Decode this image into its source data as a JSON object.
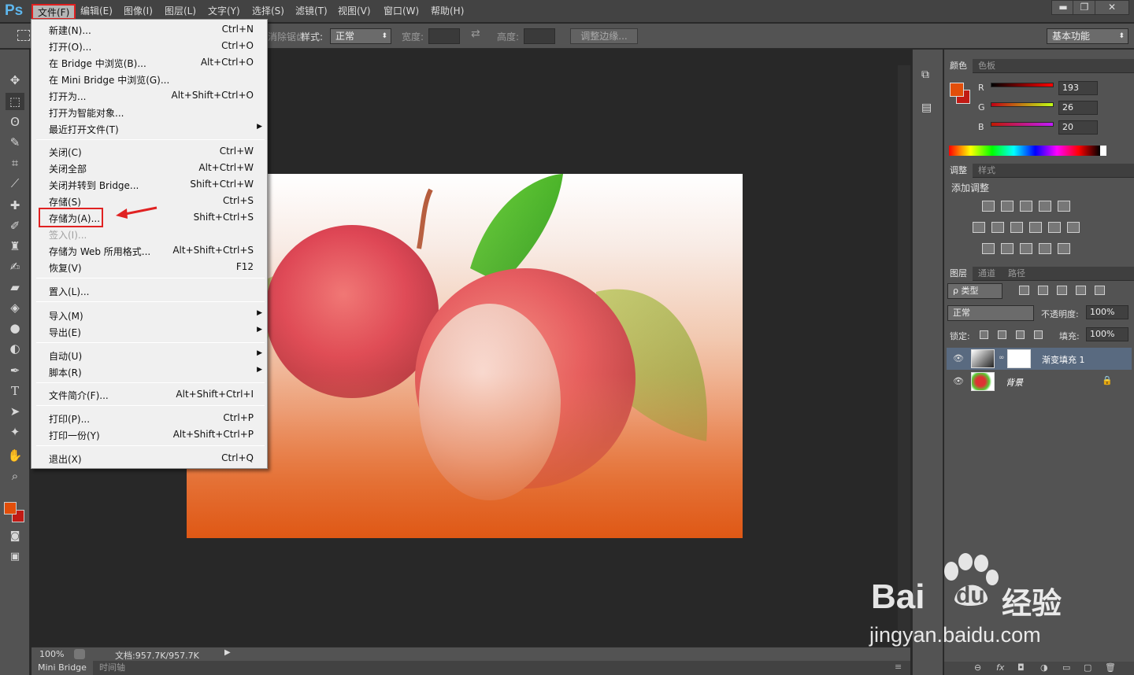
{
  "app": {
    "logo": "Ps"
  },
  "menubar": {
    "items": [
      "文件(F)",
      "编辑(E)",
      "图像(I)",
      "图层(L)",
      "文字(Y)",
      "选择(S)",
      "滤镜(T)",
      "视图(V)",
      "窗口(W)",
      "帮助(H)"
    ],
    "window_buttons": [
      "▬",
      "❐",
      "✕"
    ]
  },
  "options": {
    "antialias_label": "消除锯齿",
    "style_label": "样式:",
    "style_value": "正常",
    "width_label": "宽度:",
    "height_label": "高度:",
    "refine_label": "调整边缘...",
    "workspace": "基本功能"
  },
  "file_menu": [
    {
      "label": "新建(N)...",
      "shortcut": "Ctrl+N"
    },
    {
      "label": "打开(O)...",
      "shortcut": "Ctrl+O"
    },
    {
      "label": "在 Bridge 中浏览(B)...",
      "shortcut": "Alt+Ctrl+O"
    },
    {
      "label": "在 Mini Bridge 中浏览(G)...",
      "shortcut": ""
    },
    {
      "label": "打开为...",
      "shortcut": "Alt+Shift+Ctrl+O"
    },
    {
      "label": "打开为智能对象...",
      "shortcut": ""
    },
    {
      "label": "最近打开文件(T)",
      "shortcut": "",
      "submenu": true
    },
    {
      "label": "关闭(C)",
      "shortcut": "Ctrl+W"
    },
    {
      "label": "关闭全部",
      "shortcut": "Alt+Ctrl+W"
    },
    {
      "label": "关闭并转到 Bridge...",
      "shortcut": "Shift+Ctrl+W"
    },
    {
      "label": "存储(S)",
      "shortcut": "Ctrl+S"
    },
    {
      "label": "存储为(A)...",
      "shortcut": "Shift+Ctrl+S",
      "highlighted": true
    },
    {
      "label": "签入(I)...",
      "shortcut": "",
      "disabled": true
    },
    {
      "label": "存储为 Web 所用格式...",
      "shortcut": "Alt+Shift+Ctrl+S"
    },
    {
      "label": "恢复(V)",
      "shortcut": "F12"
    },
    {
      "label": "置入(L)...",
      "shortcut": ""
    },
    {
      "label": "导入(M)",
      "shortcut": "",
      "submenu": true
    },
    {
      "label": "导出(E)",
      "shortcut": "",
      "submenu": true
    },
    {
      "label": "自动(U)",
      "shortcut": "",
      "submenu": true
    },
    {
      "label": "脚本(R)",
      "shortcut": "",
      "submenu": true
    },
    {
      "label": "文件简介(F)...",
      "shortcut": "Alt+Shift+Ctrl+I"
    },
    {
      "label": "打印(P)...",
      "shortcut": "Ctrl+P"
    },
    {
      "label": "打印一份(Y)",
      "shortcut": "Alt+Shift+Ctrl+P"
    },
    {
      "label": "退出(X)",
      "shortcut": "Ctrl+Q"
    }
  ],
  "color_panel": {
    "tabs": [
      "颜色",
      "色板"
    ],
    "r_label": "R",
    "g_label": "G",
    "b_label": "B",
    "r": "193",
    "g": "26",
    "b": "20",
    "fg_color": "#c11a14"
  },
  "adjust_panel": {
    "tabs": [
      "调整",
      "样式"
    ],
    "title": "添加调整"
  },
  "layers_panel": {
    "tabs": [
      "图层",
      "通道",
      "路径"
    ],
    "filter": "ρ 类型",
    "blend": "正常",
    "opacity_label": "不透明度:",
    "opacity": "100%",
    "lock_label": "锁定:",
    "fill_label": "填充:",
    "fill": "100%",
    "layers": [
      {
        "name": "渐变填充 1",
        "selected": true
      },
      {
        "name": "背景",
        "selected": false
      }
    ]
  },
  "status": {
    "zoom": "100%",
    "doc": "文档:957.7K/957.7K"
  },
  "bottom_tabs": [
    "Mini Bridge",
    "时间轴"
  ],
  "watermark": {
    "brand": "Bai",
    "brand2": "du",
    "cn": "经验",
    "url": "jingyan.baidu.com"
  }
}
